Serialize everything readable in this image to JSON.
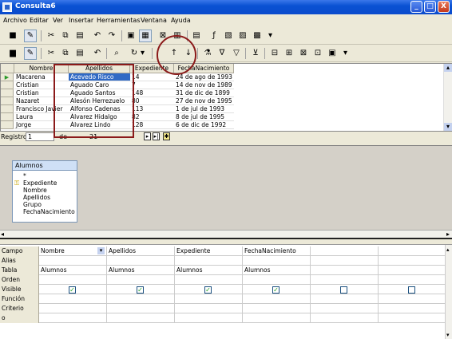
{
  "window": {
    "title": "Consulta6",
    "min_label": "_",
    "max_label": "□",
    "close_label": "X"
  },
  "menubar": [
    "Archivo",
    "Editar",
    "Ver",
    "Insertar",
    "Herramientas",
    "Ventana",
    "Ayuda"
  ],
  "grid": {
    "columns": [
      "Nombre",
      "Apellidos",
      "Expediente",
      "FechaNacimiento"
    ],
    "rows": [
      [
        "Macarena",
        "Acevedo Risco",
        "14",
        "24 de ago de 1993"
      ],
      [
        "Cristian",
        "Aguado Caro",
        "7",
        "14 de nov de 1989"
      ],
      [
        "Cristian",
        "Aguado Santos",
        "148",
        "31 de dic de 1899"
      ],
      [
        "Nazaret",
        "Alesón Herrezuelo",
        "80",
        "27 de nov de 1995"
      ],
      [
        "Francisco Javier",
        "Alfonso Cadenas",
        "113",
        "1 de jul de 1993"
      ],
      [
        "Laura",
        "Álvarez Hidalgo",
        "82",
        "8 de jul de 1995"
      ],
      [
        "Jorge",
        "Álvarez Lindo",
        "128",
        "6 de dic de 1992"
      ]
    ],
    "current_row_marker": "▶"
  },
  "status": {
    "label": "Registro",
    "value": "1",
    "of": "de",
    "total": "21"
  },
  "table_box": {
    "title": "Alumnos",
    "fields": [
      "*",
      "Expediente",
      "Nombre",
      "Apellidos",
      "Grupo",
      "FechaNacimiento"
    ]
  },
  "design": {
    "row_labels": [
      "Campo",
      "Alias",
      "Tabla",
      "Orden",
      "Visible",
      "Función",
      "Criterio",
      "o"
    ],
    "fields": [
      "Nombre",
      "Apellidos",
      "Expediente",
      "FechaNacimiento",
      "",
      ""
    ],
    "tables": [
      "Alumnos",
      "Alumnos",
      "Alumnos",
      "Alumnos",
      "",
      ""
    ],
    "visible": [
      true,
      true,
      true,
      true,
      false,
      false
    ]
  },
  "colors": {
    "titlebar": "#0a52d3",
    "annotation": "#8b1a1a",
    "selected_cell": "#316ac5"
  }
}
